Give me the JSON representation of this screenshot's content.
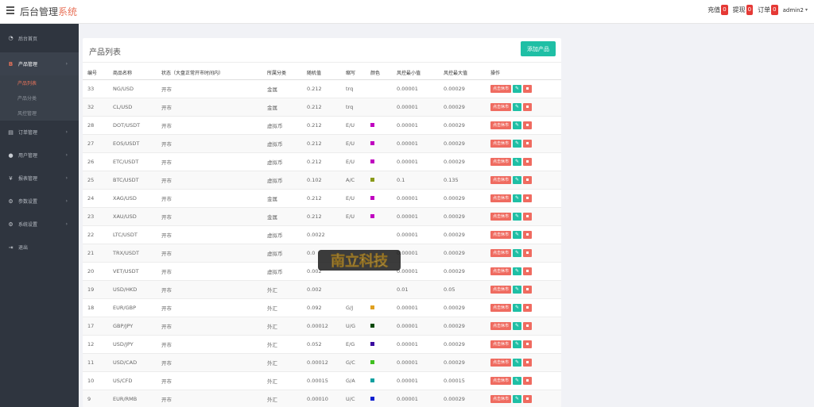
{
  "header": {
    "title_main": "后台管理",
    "title_accent": "系统",
    "links": [
      {
        "label": "充值",
        "count": "0"
      },
      {
        "label": "提现",
        "count": "0"
      },
      {
        "label": "订单",
        "count": "0"
      }
    ],
    "user": "admin2"
  },
  "sidebar": {
    "items": [
      {
        "label": "后台首页",
        "icon": "dashboard-icon"
      },
      {
        "label": "产品管理",
        "icon": "bitcoin-icon"
      },
      {
        "label": "订单管理",
        "icon": "file-icon"
      },
      {
        "label": "用户管理",
        "icon": "user-icon"
      },
      {
        "label": "报表管理",
        "icon": "yen-icon"
      },
      {
        "label": "参数设置",
        "icon": "gear-icon"
      },
      {
        "label": "系统设置",
        "icon": "gears-icon"
      },
      {
        "label": "退出",
        "icon": "logout-icon"
      }
    ],
    "sub_items": [
      "产品列表",
      "产品分类",
      "风控管理"
    ]
  },
  "panel": {
    "title": "产品列表",
    "add_button": "添加产品"
  },
  "table": {
    "headers": [
      "编号",
      "商品名称",
      "状态（大盘正常开市时间内）",
      "所属分类",
      "随机值",
      "缩写",
      "颜色",
      "风控最小值",
      "风控最大值",
      "操作"
    ],
    "op_label": "点击休市",
    "rows": [
      {
        "id": "33",
        "name": "NG/USD",
        "status": "开市",
        "category": "金属",
        "random": "0.212",
        "abbr": "trq",
        "color": "",
        "min": "0.00001",
        "max": "0.00029"
      },
      {
        "id": "32",
        "name": "CL/USD",
        "status": "开市",
        "category": "金属",
        "random": "0.212",
        "abbr": "trq",
        "color": "",
        "min": "0.00001",
        "max": "0.00029"
      },
      {
        "id": "28",
        "name": "DOT/USDT",
        "status": "开市",
        "category": "虚拟币",
        "random": "0.212",
        "abbr": "E/U",
        "color": "#c000c0",
        "min": "0.00001",
        "max": "0.00029"
      },
      {
        "id": "27",
        "name": "EOS/USDT",
        "status": "开市",
        "category": "虚拟币",
        "random": "0.212",
        "abbr": "E/U",
        "color": "#c000c0",
        "min": "0.00001",
        "max": "0.00029"
      },
      {
        "id": "26",
        "name": "ETC/USDT",
        "status": "开市",
        "category": "虚拟币",
        "random": "0.212",
        "abbr": "E/U",
        "color": "#c000c0",
        "min": "0.00001",
        "max": "0.00029"
      },
      {
        "id": "25",
        "name": "BTC/USDT",
        "status": "开市",
        "category": "虚拟币",
        "random": "0.102",
        "abbr": "A/C",
        "color": "#8a9a1a",
        "min": "0.1",
        "max": "0.135"
      },
      {
        "id": "24",
        "name": "XAG/USD",
        "status": "开市",
        "category": "金属",
        "random": "0.212",
        "abbr": "E/U",
        "color": "#c000c0",
        "min": "0.00001",
        "max": "0.00029"
      },
      {
        "id": "23",
        "name": "XAU/USD",
        "status": "开市",
        "category": "金属",
        "random": "0.212",
        "abbr": "E/U",
        "color": "#c000c0",
        "min": "0.00001",
        "max": "0.00029"
      },
      {
        "id": "22",
        "name": "LTC/USDT",
        "status": "开市",
        "category": "虚拟币",
        "random": "0.0022",
        "abbr": "",
        "color": "",
        "min": "0.00001",
        "max": "0.00029"
      },
      {
        "id": "21",
        "name": "TRX/USDT",
        "status": "开市",
        "category": "虚拟币",
        "random": "0.0",
        "abbr": "",
        "color": "",
        "min": "0.00001",
        "max": "0.00029"
      },
      {
        "id": "20",
        "name": "VET/USDT",
        "status": "开市",
        "category": "虚拟币",
        "random": "0.002",
        "abbr": "",
        "color": "",
        "min": "0.00001",
        "max": "0.00029"
      },
      {
        "id": "19",
        "name": "USD/HKD",
        "status": "开市",
        "category": "外汇",
        "random": "0.002",
        "abbr": "",
        "color": "",
        "min": "0.01",
        "max": "0.05"
      },
      {
        "id": "18",
        "name": "EUR/GBP",
        "status": "开市",
        "category": "外汇",
        "random": "0.092",
        "abbr": "G/J",
        "color": "#e0a020",
        "min": "0.00001",
        "max": "0.00029"
      },
      {
        "id": "17",
        "name": "GBP/JPY",
        "status": "开市",
        "category": "外汇",
        "random": "0.00012",
        "abbr": "U/G",
        "color": "#0a4a0a",
        "min": "0.00001",
        "max": "0.00029"
      },
      {
        "id": "12",
        "name": "USD/JPY",
        "status": "开市",
        "category": "外汇",
        "random": "0.052",
        "abbr": "E/G",
        "color": "#3a0aa0",
        "min": "0.00001",
        "max": "0.00029"
      },
      {
        "id": "11",
        "name": "USD/CAD",
        "status": "开市",
        "category": "外汇",
        "random": "0.00012",
        "abbr": "G/C",
        "color": "#40c020",
        "min": "0.00001",
        "max": "0.00029"
      },
      {
        "id": "10",
        "name": "US/CFD",
        "status": "开市",
        "category": "外汇",
        "random": "0.00015",
        "abbr": "G/A",
        "color": "#10a0a0",
        "min": "0.00001",
        "max": "0.00015"
      },
      {
        "id": "9",
        "name": "EUR/RMB",
        "status": "开市",
        "category": "外汇",
        "random": "0.00010",
        "abbr": "U/C",
        "color": "#1020d0",
        "min": "0.00001",
        "max": "0.00029"
      }
    ]
  },
  "watermark": {
    "text": "南立科技"
  }
}
